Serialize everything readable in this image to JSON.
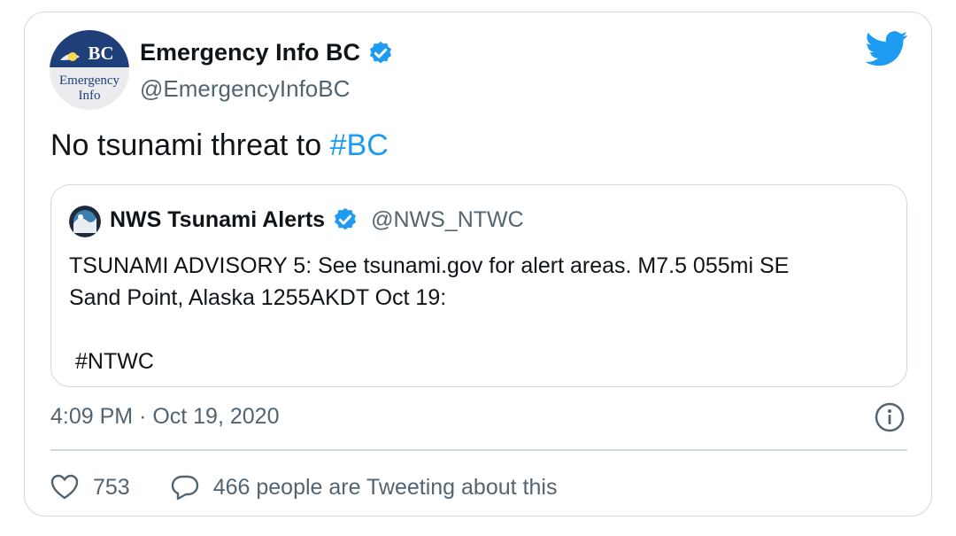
{
  "tweet": {
    "avatar": {
      "top_text": "BC",
      "bottom_line1": "Emergency",
      "bottom_line2": "Info"
    },
    "display_name": "Emergency Info BC",
    "handle": "@EmergencyInfoBC",
    "text_prefix": "No tsunami threat to ",
    "hashtag": "#BC",
    "timestamp": "4:09 PM · Oct 19, 2020"
  },
  "quoted": {
    "display_name": "NWS Tsunami Alerts",
    "handle": "@NWS_NTWC",
    "text_line1": "TSUNAMI ADVISORY 5: See tsunami.gov for alert areas.  M7.5 055mi SE",
    "text_line2": "Sand Point, Alaska 1255AKDT Oct 19:",
    "hashtag": "#NTWC"
  },
  "actions": {
    "like_count": "753",
    "reply_text": "466 people are Tweeting about this"
  },
  "icons": {
    "brand": "twitter-bird-icon",
    "verified": "verified-badge-icon",
    "info": "info-icon",
    "like": "heart-icon",
    "reply": "speech-bubble-icon"
  },
  "colors": {
    "accent": "#1d9bf0",
    "text": "#0f1419",
    "muted": "#536471",
    "border": "#cfd9de"
  }
}
